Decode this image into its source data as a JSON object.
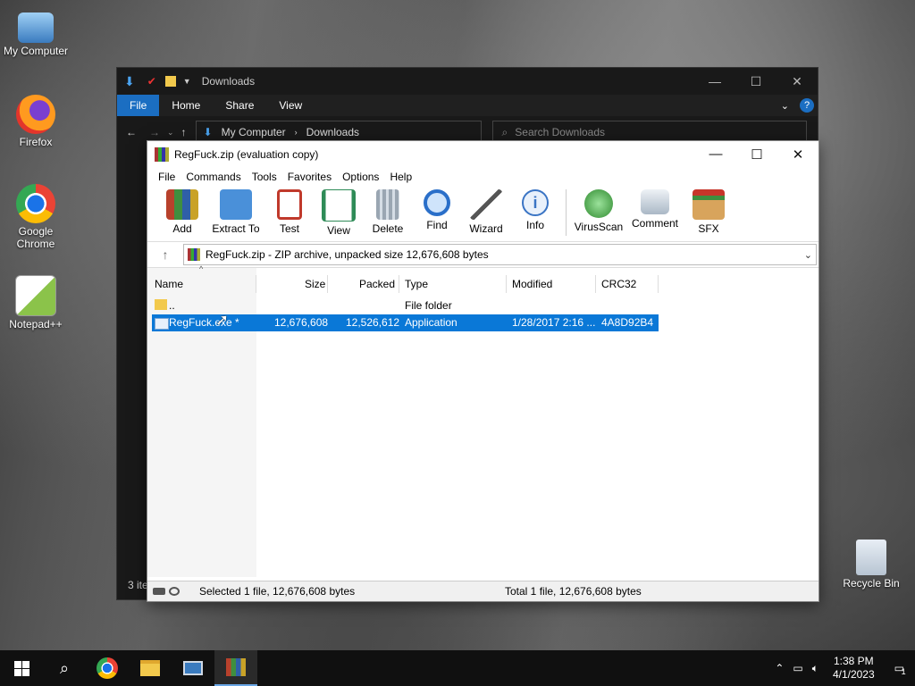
{
  "desktop": {
    "icons": [
      {
        "label": "My Computer"
      },
      {
        "label": "Firefox"
      },
      {
        "label": "Google Chrome"
      },
      {
        "label": "Notepad++"
      },
      {
        "label": "Recycle Bin"
      }
    ]
  },
  "explorer": {
    "title": "Downloads",
    "tabs": [
      "File",
      "Home",
      "Share",
      "View"
    ],
    "breadcrumb": [
      "My Computer",
      "Downloads"
    ],
    "search_placeholder": "Search Downloads",
    "status": "3 ite"
  },
  "winrar": {
    "title": "RegFuck.zip (evaluation copy)",
    "menu": [
      "File",
      "Commands",
      "Tools",
      "Favorites",
      "Options",
      "Help"
    ],
    "toolbar": [
      {
        "label": "Add",
        "icon": "add-icon",
        "color": "#b8412c"
      },
      {
        "label": "Extract To",
        "icon": "extract-folder-icon",
        "color": "#4a90d9"
      },
      {
        "label": "Test",
        "icon": "test-clipboard-icon",
        "color": "#c0392b"
      },
      {
        "label": "View",
        "icon": "view-book-icon",
        "color": "#2e8b57"
      },
      {
        "label": "Delete",
        "icon": "trash-icon",
        "color": "#8e9aa6"
      },
      {
        "label": "Find",
        "icon": "magnifier-icon",
        "color": "#2a6fc9"
      },
      {
        "label": "Wizard",
        "icon": "wand-icon",
        "color": "#7a7a7a"
      },
      {
        "label": "Info",
        "icon": "info-icon",
        "color": "#3a74c4"
      },
      {
        "label": "VirusScan",
        "icon": "virus-scan-icon",
        "color": "#3a9a3a"
      },
      {
        "label": "Comment",
        "icon": "comment-icon",
        "color": "#6c8aa8"
      },
      {
        "label": "SFX",
        "icon": "sfx-box-icon",
        "color": "#c98a3c"
      }
    ],
    "path": "RegFuck.zip - ZIP archive, unpacked size 12,676,608 bytes",
    "columns": [
      "Name",
      "Size",
      "Packed",
      "Type",
      "Modified",
      "CRC32"
    ],
    "rows": [
      {
        "name": "..",
        "size": "",
        "packed": "",
        "type": "File folder",
        "modified": "",
        "crc": ""
      },
      {
        "name": "RegFuck.exe *",
        "size": "12,676,608",
        "packed": "12,526,612",
        "type": "Application",
        "modified": "1/28/2017 2:16 ...",
        "crc": "4A8D92B4"
      }
    ],
    "status_left": "Selected 1 file, 12,676,608 bytes",
    "status_right": "Total 1 file, 12,676,608 bytes"
  },
  "taskbar": {
    "time": "1:38 PM",
    "date": "4/1/2023",
    "notification_count": "1"
  }
}
